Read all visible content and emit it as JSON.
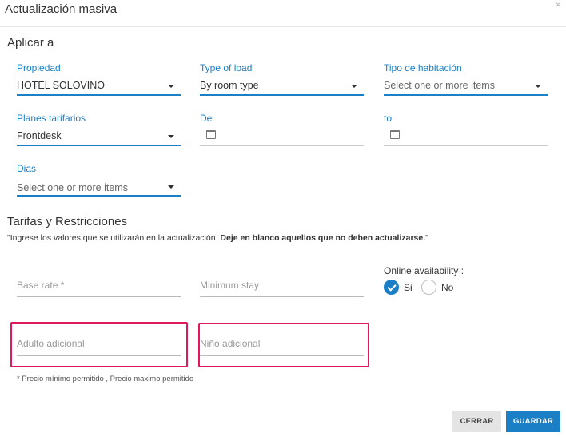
{
  "modal": {
    "title": "Actualización masiva",
    "close_icon": "close-icon"
  },
  "apply": {
    "section_title": "Aplicar a",
    "property": {
      "label": "Propiedad",
      "value": "HOTEL SOLOVINO"
    },
    "load_type": {
      "label": "Type of load",
      "value": "By room type"
    },
    "room_type": {
      "label": "Tipo de habitación",
      "placeholder": "Select one or more items"
    },
    "rate_plans": {
      "label": "Planes tarifarios",
      "value": "Frontdesk"
    },
    "from": {
      "label": "De",
      "icon": "calendar-icon"
    },
    "to": {
      "label": "to",
      "icon": "calendar-icon"
    },
    "days": {
      "label": "Dias",
      "placeholder": "Select one or more items"
    }
  },
  "rates": {
    "section_title": "Tarifas y Restricciones",
    "note_prefix": "\"Ingrese los valores que se utilizarán en la actualización. ",
    "note_bold": "Deje en blanco aquellos que no deben actualizarse.",
    "note_suffix": "\"",
    "base_rate": {
      "placeholder": "Base rate *"
    },
    "min_stay": {
      "placeholder": "Minimum stay"
    },
    "adult_extra": {
      "placeholder": "Adulto adicional"
    },
    "child_extra": {
      "placeholder": "Niño adicional"
    },
    "availability": {
      "label": "Online availability :",
      "yes": "Si",
      "no": "No",
      "selected": "Si"
    },
    "hint": "* Precio mínimo permitido , Precio maximo permitido"
  },
  "actions": {
    "cancel": "CERRAR",
    "save": "GUARDAR"
  },
  "colors": {
    "accent": "#1a7fc4",
    "highlight": "#e0195a"
  }
}
